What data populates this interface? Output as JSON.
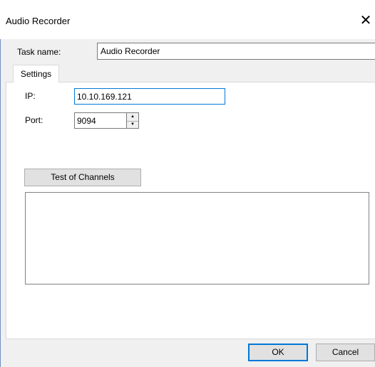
{
  "window": {
    "title": "Audio Recorder",
    "close_icon": "close-icon"
  },
  "task": {
    "label": "Task name:",
    "value": "Audio Recorder"
  },
  "tabs": [
    {
      "label": "Settings",
      "active": true
    }
  ],
  "settings": {
    "ip_label": "IP:",
    "ip_value": "10.10.169.121",
    "port_label": "Port:",
    "port_value": "9094",
    "test_button_label": "Test of Channels"
  },
  "footer": {
    "ok_label": "OK",
    "cancel_label": "Cancel"
  },
  "colors": {
    "focus_accent": "#0078d7",
    "dialog_background": "#f0f0f0",
    "button_face": "#e1e1e1"
  }
}
